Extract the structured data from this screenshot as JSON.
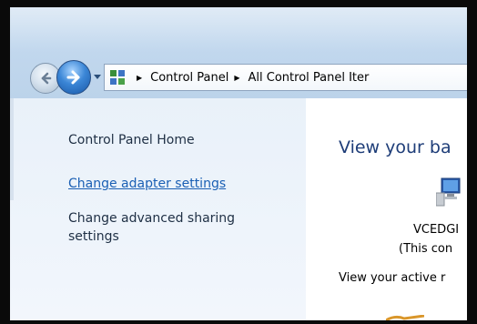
{
  "window": {
    "address": {
      "crumbs": [
        "Control Panel",
        "All Control Panel Iter"
      ]
    }
  },
  "sidebar": {
    "home_label": "Control Panel Home",
    "adapter_link": "Change adapter settings",
    "sharing_link": "Change advanced sharing settings"
  },
  "main": {
    "title": "View your ba",
    "computer_name": "VCEDGI",
    "computer_sub": "(This con",
    "active_text": "View your active r"
  },
  "colors": {
    "link": "#1a5fb4",
    "title": "#1e3d78",
    "sidebar_bg": "#eef4fb",
    "titlebar_bg": "#c2d8ee"
  },
  "icons": {
    "back": "back-arrow-icon",
    "forward": "forward-arrow-icon",
    "dropdown": "chevron-down-icon",
    "control_panel": "control-panel-icon",
    "computer": "computer-icon"
  }
}
